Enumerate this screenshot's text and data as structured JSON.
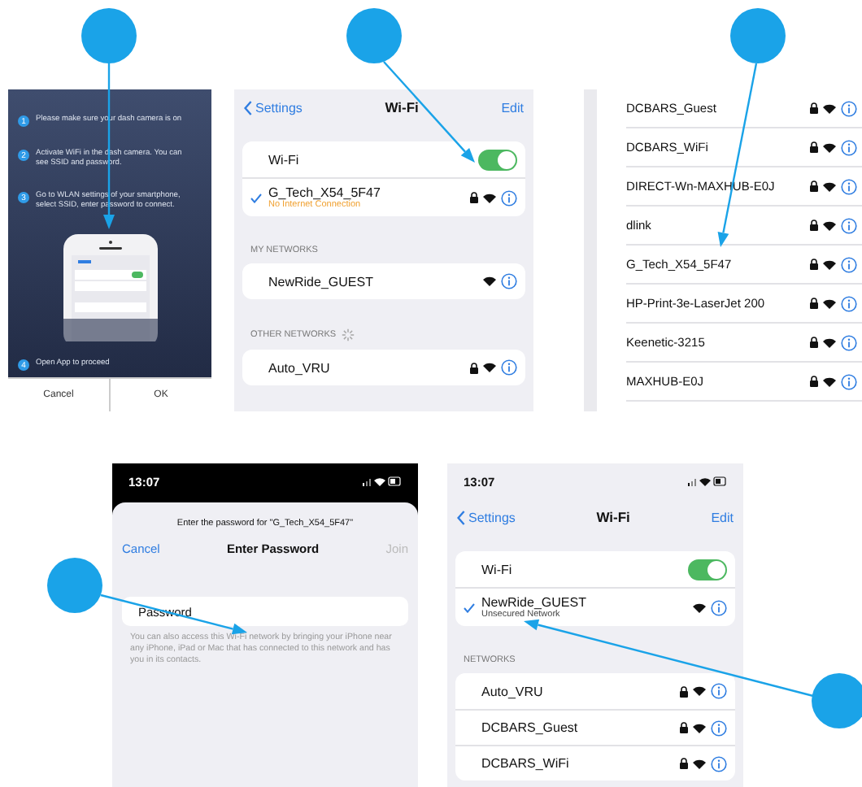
{
  "app_instructions": {
    "steps": [
      {
        "number": "1",
        "text": "Please make sure your dash camera is on"
      },
      {
        "number": "2",
        "text": "Activate WiFi in the dash camera. You can see SSID and password."
      },
      {
        "number": "3",
        "text": "Go to WLAN settings of your smartphone, select SSID, enter password to connect."
      },
      {
        "number": "4",
        "text": "Open App to proceed"
      }
    ],
    "buttons": [
      "Cancel",
      "OK"
    ]
  },
  "wifi_settings": {
    "back": "Settings",
    "title": "Wi-Fi",
    "edit": "Edit",
    "wifi_label": "Wi-Fi",
    "wifi_on": true,
    "connected": {
      "name": "G_Tech_X54_5F47",
      "subtitle": "No Internet Connection",
      "warning": true,
      "secured": true
    },
    "sections": [
      {
        "header": "MY NETWORKS",
        "loading": false,
        "networks": [
          {
            "name": "NewRide_GUEST",
            "secured": false
          }
        ]
      },
      {
        "header": "OTHER NETWORKS",
        "loading": true,
        "networks": [
          {
            "name": "Auto_VRU",
            "secured": true
          }
        ]
      }
    ]
  },
  "network_list": {
    "networks": [
      {
        "name": "DCBARS_Guest",
        "secured": true
      },
      {
        "name": "DCBARS_WiFi",
        "secured": true
      },
      {
        "name": "DIRECT-Wn-MAXHUB-E0J",
        "secured": true
      },
      {
        "name": "dlink",
        "secured": true
      },
      {
        "name": "G_Tech_X54_5F47",
        "secured": true
      },
      {
        "name": "HP-Print-3e-LaserJet 200",
        "secured": true
      },
      {
        "name": "Keenetic-3215",
        "secured": true
      },
      {
        "name": "MAXHUB-E0J",
        "secured": true
      }
    ]
  },
  "password_sheet": {
    "time": "13:07",
    "prompt": "Enter the password for \"G_Tech_X54_5F47\"",
    "cancel": "Cancel",
    "title": "Enter Password",
    "join": {
      "label": "Join",
      "disabled": true
    },
    "placeholder": "Password",
    "note": "You can also access this Wi-Fi network by bringing your iPhone near any iPhone, iPad or Mac that has connected to this network and has you in its contacts."
  },
  "wifi_connected": {
    "time": "13:07",
    "back": "Settings",
    "title": "Wi-Fi",
    "edit": "Edit",
    "wifi_label": "Wi-Fi",
    "wifi_on": true,
    "connected": {
      "name": "NewRide_GUEST",
      "subtitle": "Unsecured Network",
      "warning": false,
      "secured": false
    },
    "sections": [
      {
        "header": "NETWORKS",
        "loading": false,
        "networks": [
          {
            "name": "Auto_VRU",
            "secured": true
          },
          {
            "name": "DCBARS_Guest",
            "secured": true
          },
          {
            "name": "DCBARS_WiFi",
            "secured": true
          }
        ]
      }
    ]
  }
}
